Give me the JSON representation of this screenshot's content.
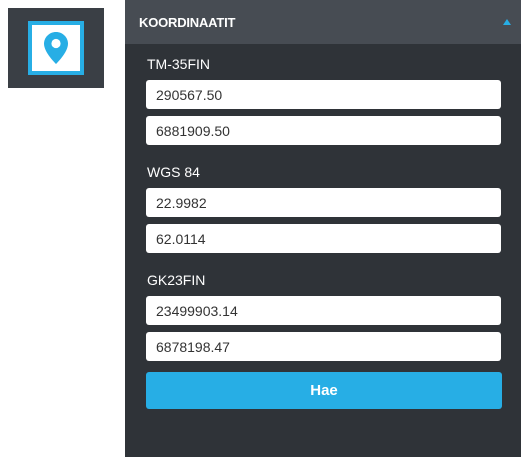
{
  "toolbar": {
    "location_button": {
      "icon": "map-pin-icon",
      "accent_color": "#27aee5"
    }
  },
  "panel": {
    "title": "KOORDINAATIT",
    "collapse_icon": "caret-up-icon",
    "sections": [
      {
        "label": "TM-35FIN",
        "x": "290567.50",
        "y": "6881909.50"
      },
      {
        "label": "WGS 84",
        "x": "22.9982",
        "y": "62.0114"
      },
      {
        "label": "GK23FIN",
        "x": "23499903.14",
        "y": "6878198.47"
      }
    ],
    "search_label": "Hae"
  },
  "colors": {
    "panel_bg": "#2f3338",
    "header_bg": "#474c53",
    "accent": "#27aee5"
  }
}
